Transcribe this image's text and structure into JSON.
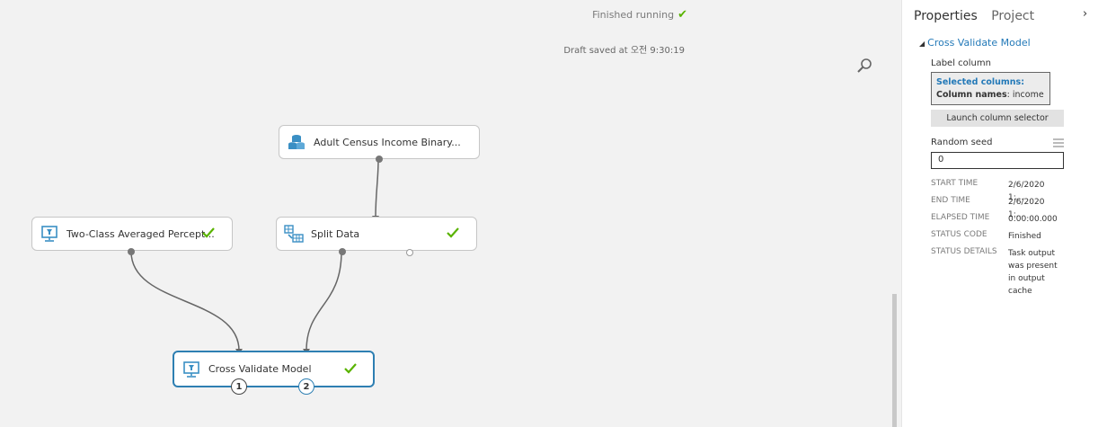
{
  "canvas": {
    "run_status": "Finished running",
    "draft_saved": "Draft saved at 오전 9:30:19",
    "nodes": {
      "adult_census": {
        "label": "Adult Census Income Binary..."
      },
      "two_class": {
        "label": "Two-Class Averaged Percept..."
      },
      "split_data": {
        "label": "Split Data"
      },
      "cross_validate": {
        "label": "Cross Validate Model",
        "port1": "1",
        "port2": "2"
      }
    }
  },
  "panel": {
    "tabs": [
      "Properties",
      "Project"
    ],
    "section_title": "Cross Validate Model",
    "label_column_label": "Label column",
    "selected_columns_label": "Selected columns:",
    "column_names_key": "Column names",
    "column_names_value": ": income",
    "launch_button": "Launch column selector",
    "random_seed_label": "Random seed",
    "random_seed_value": "0",
    "stats": [
      {
        "key": "START TIME",
        "value": "2/6/2020 1:..."
      },
      {
        "key": "END TIME",
        "value": "2/6/2020 1:..."
      },
      {
        "key": "ELAPSED TIME",
        "value": "0:00:00.000"
      },
      {
        "key": "STATUS CODE",
        "value": "Finished"
      },
      {
        "key": "STATUS DETAILS",
        "value": "Task output was present in output cache"
      }
    ]
  },
  "colors": {
    "accent": "#2379b8",
    "check": "#59b300",
    "selected_border": "#2e7fb2"
  }
}
